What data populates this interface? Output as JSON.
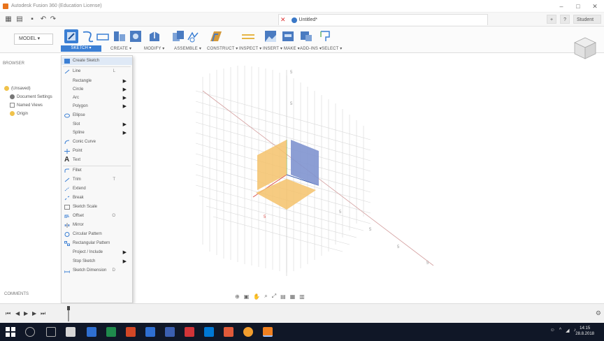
{
  "window": {
    "title": "Autodesk Fusion 360 (Education License)",
    "controls": [
      "–",
      "□",
      "✕"
    ]
  },
  "quick_access": {
    "document_tab": "Untitled*",
    "right_buttons": [
      "+",
      "?"
    ],
    "profile": "Student"
  },
  "ribbon": {
    "workspace": "MODEL ▾",
    "groups": [
      "SKETCH ▾",
      "CREATE ▾",
      "MODIFY ▾",
      "ASSEMBLE ▾",
      "CONSTRUCT ▾",
      "INSPECT ▾",
      "INSERT ▾",
      "MAKE ▾",
      "ADD-INS ▾",
      "SELECT ▾"
    ]
  },
  "browser": {
    "header": "BROWSER",
    "rows": [
      "(Unsaved)",
      "Document Settings",
      "Named Views",
      "Origin"
    ]
  },
  "sketch_menu": {
    "items": [
      {
        "label": "Create Sketch",
        "shortcut": "",
        "submenu": false
      },
      {
        "label": "Line",
        "shortcut": "L",
        "submenu": false
      },
      {
        "label": "Rectangle",
        "shortcut": "",
        "submenu": true
      },
      {
        "label": "Circle",
        "shortcut": "",
        "submenu": true
      },
      {
        "label": "Arc",
        "shortcut": "",
        "submenu": true
      },
      {
        "label": "Polygon",
        "shortcut": "",
        "submenu": true
      },
      {
        "label": "Ellipse",
        "shortcut": "",
        "submenu": false
      },
      {
        "label": "Slot",
        "shortcut": "",
        "submenu": true
      },
      {
        "label": "Spline",
        "shortcut": "",
        "submenu": true
      },
      {
        "label": "Conic Curve",
        "shortcut": "",
        "submenu": false
      },
      {
        "label": "Point",
        "shortcut": "",
        "submenu": false
      },
      {
        "label": "Text",
        "shortcut": "",
        "submenu": false
      },
      {
        "label": "Fillet",
        "shortcut": "",
        "submenu": false
      },
      {
        "label": "Trim",
        "shortcut": "T",
        "submenu": false
      },
      {
        "label": "Extend",
        "shortcut": "",
        "submenu": false
      },
      {
        "label": "Break",
        "shortcut": "",
        "submenu": false
      },
      {
        "label": "Sketch Scale",
        "shortcut": "",
        "submenu": false
      },
      {
        "label": "Offset",
        "shortcut": "O",
        "submenu": false
      },
      {
        "label": "Mirror",
        "shortcut": "",
        "submenu": false
      },
      {
        "label": "Circular Pattern",
        "shortcut": "",
        "submenu": false
      },
      {
        "label": "Rectangular Pattern",
        "shortcut": "",
        "submenu": false
      },
      {
        "label": "Project / Include",
        "shortcut": "",
        "submenu": true
      },
      {
        "label": "Stop Sketch",
        "shortcut": "",
        "submenu": true
      },
      {
        "label": "Sketch Dimension",
        "shortcut": "D",
        "submenu": false
      }
    ]
  },
  "comments": {
    "label": "COMMENTS"
  },
  "taskbar": {
    "time": "14:15",
    "date": "28.8.2018"
  },
  "colors": {
    "accent": "#3b7fd4",
    "plane_orange": "#f5c26b",
    "plane_blue": "#7f94cf",
    "axis_red": "#d9534f",
    "axis_green": "#6cb46c"
  }
}
